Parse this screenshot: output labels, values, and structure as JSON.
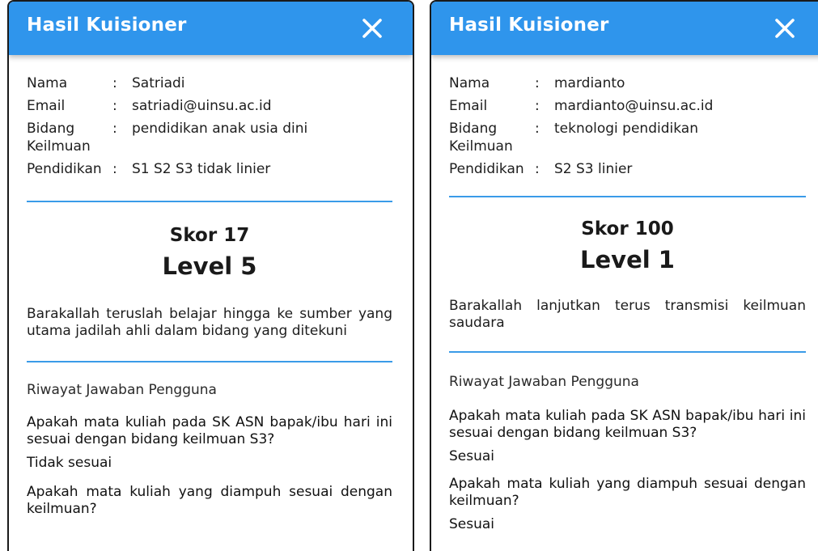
{
  "panels": [
    {
      "title": "Hasil Kuisioner",
      "fields": [
        {
          "label": "Nama",
          "colon": ":",
          "value": "Satriadi"
        },
        {
          "label": "Email",
          "colon": ":",
          "value": "satriadi@uinsu.ac.id"
        },
        {
          "label": "Bidang Keilmuan",
          "colon": ":",
          "value": "pendidikan anak usia dini"
        },
        {
          "label": "Pendidikan",
          "colon": ":",
          "value": "S1 S2 S3 tidak linier"
        }
      ],
      "skor": "Skor 17",
      "level": "Level 5",
      "message": "Barakallah teruslah belajar hingga ke sumber yang utama jadilah ahli dalam bidang yang ditekuni",
      "riwayat_title": "Riwayat Jawaban Pengguna",
      "history": [
        {
          "question": "Apakah mata kuliah pada SK ASN bapak/ibu hari ini sesuai dengan bidang keilmuan S3?",
          "answer": "Tidak sesuai"
        },
        {
          "question": "Apakah mata kuliah yang diampuh sesuai dengan keilmuan?",
          "answer": ""
        }
      ]
    },
    {
      "title": "Hasil Kuisioner",
      "fields": [
        {
          "label": "Nama",
          "colon": ":",
          "value": "mardianto"
        },
        {
          "label": "Email",
          "colon": ":",
          "value": "mardianto@uinsu.ac.id"
        },
        {
          "label": "Bidang Keilmuan",
          "colon": ":",
          "value": "teknologi pendidikan"
        },
        {
          "label": "Pendidikan",
          "colon": ":",
          "value": "S2 S3 linier"
        }
      ],
      "skor": "Skor 100",
      "level": "Level 1",
      "message": "Barakallah lanjutkan terus transmisi keilmuan saudara",
      "riwayat_title": "Riwayat Jawaban Pengguna",
      "history": [
        {
          "question": "Apakah mata kuliah pada SK ASN bapak/ibu hari ini sesuai dengan bidang keilmuan S3?",
          "answer": "Sesuai"
        },
        {
          "question": "Apakah mata kuliah yang diampuh sesuai dengan keilmuan?",
          "answer": "Sesuai"
        }
      ]
    }
  ],
  "colors": {
    "header_bg": "#2f95ec",
    "divider": "#3a9be8",
    "text": "#1d1d1d"
  },
  "icons": {
    "close": "close-icon"
  }
}
